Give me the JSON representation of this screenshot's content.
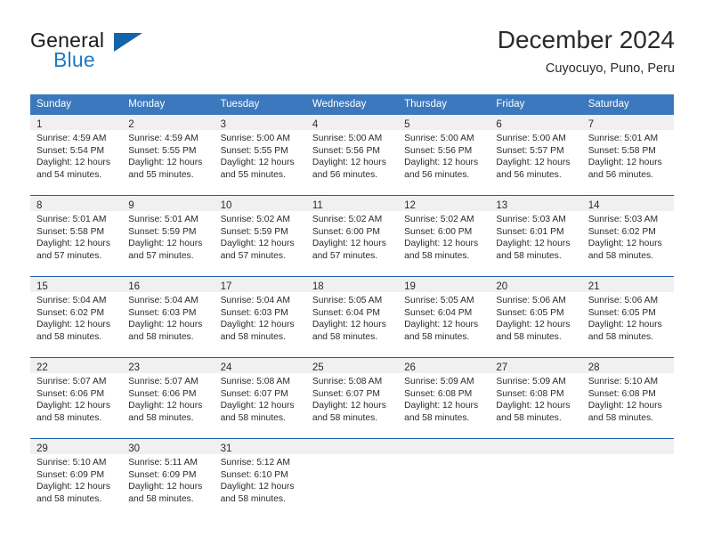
{
  "logo": {
    "word1": "General",
    "word2": "Blue",
    "triangle_color": "#1464aa",
    "blue_color": "#1e7ac4"
  },
  "header": {
    "month_title": "December 2024",
    "location": "Cuyocuyo, Puno, Peru"
  },
  "calendar": {
    "header_bg": "#3b78bd",
    "week_divider": "#1f5fa8",
    "daynum_bg": "#f0f0f0",
    "weekdays": [
      "Sunday",
      "Monday",
      "Tuesday",
      "Wednesday",
      "Thursday",
      "Friday",
      "Saturday"
    ],
    "weeks": [
      [
        {
          "day": "1",
          "sunrise": "Sunrise: 4:59 AM",
          "sunset": "Sunset: 5:54 PM",
          "daylight1": "Daylight: 12 hours",
          "daylight2": "and 54 minutes."
        },
        {
          "day": "2",
          "sunrise": "Sunrise: 4:59 AM",
          "sunset": "Sunset: 5:55 PM",
          "daylight1": "Daylight: 12 hours",
          "daylight2": "and 55 minutes."
        },
        {
          "day": "3",
          "sunrise": "Sunrise: 5:00 AM",
          "sunset": "Sunset: 5:55 PM",
          "daylight1": "Daylight: 12 hours",
          "daylight2": "and 55 minutes."
        },
        {
          "day": "4",
          "sunrise": "Sunrise: 5:00 AM",
          "sunset": "Sunset: 5:56 PM",
          "daylight1": "Daylight: 12 hours",
          "daylight2": "and 56 minutes."
        },
        {
          "day": "5",
          "sunrise": "Sunrise: 5:00 AM",
          "sunset": "Sunset: 5:56 PM",
          "daylight1": "Daylight: 12 hours",
          "daylight2": "and 56 minutes."
        },
        {
          "day": "6",
          "sunrise": "Sunrise: 5:00 AM",
          "sunset": "Sunset: 5:57 PM",
          "daylight1": "Daylight: 12 hours",
          "daylight2": "and 56 minutes."
        },
        {
          "day": "7",
          "sunrise": "Sunrise: 5:01 AM",
          "sunset": "Sunset: 5:58 PM",
          "daylight1": "Daylight: 12 hours",
          "daylight2": "and 56 minutes."
        }
      ],
      [
        {
          "day": "8",
          "sunrise": "Sunrise: 5:01 AM",
          "sunset": "Sunset: 5:58 PM",
          "daylight1": "Daylight: 12 hours",
          "daylight2": "and 57 minutes."
        },
        {
          "day": "9",
          "sunrise": "Sunrise: 5:01 AM",
          "sunset": "Sunset: 5:59 PM",
          "daylight1": "Daylight: 12 hours",
          "daylight2": "and 57 minutes."
        },
        {
          "day": "10",
          "sunrise": "Sunrise: 5:02 AM",
          "sunset": "Sunset: 5:59 PM",
          "daylight1": "Daylight: 12 hours",
          "daylight2": "and 57 minutes."
        },
        {
          "day": "11",
          "sunrise": "Sunrise: 5:02 AM",
          "sunset": "Sunset: 6:00 PM",
          "daylight1": "Daylight: 12 hours",
          "daylight2": "and 57 minutes."
        },
        {
          "day": "12",
          "sunrise": "Sunrise: 5:02 AM",
          "sunset": "Sunset: 6:00 PM",
          "daylight1": "Daylight: 12 hours",
          "daylight2": "and 58 minutes."
        },
        {
          "day": "13",
          "sunrise": "Sunrise: 5:03 AM",
          "sunset": "Sunset: 6:01 PM",
          "daylight1": "Daylight: 12 hours",
          "daylight2": "and 58 minutes."
        },
        {
          "day": "14",
          "sunrise": "Sunrise: 5:03 AM",
          "sunset": "Sunset: 6:02 PM",
          "daylight1": "Daylight: 12 hours",
          "daylight2": "and 58 minutes."
        }
      ],
      [
        {
          "day": "15",
          "sunrise": "Sunrise: 5:04 AM",
          "sunset": "Sunset: 6:02 PM",
          "daylight1": "Daylight: 12 hours",
          "daylight2": "and 58 minutes."
        },
        {
          "day": "16",
          "sunrise": "Sunrise: 5:04 AM",
          "sunset": "Sunset: 6:03 PM",
          "daylight1": "Daylight: 12 hours",
          "daylight2": "and 58 minutes."
        },
        {
          "day": "17",
          "sunrise": "Sunrise: 5:04 AM",
          "sunset": "Sunset: 6:03 PM",
          "daylight1": "Daylight: 12 hours",
          "daylight2": "and 58 minutes."
        },
        {
          "day": "18",
          "sunrise": "Sunrise: 5:05 AM",
          "sunset": "Sunset: 6:04 PM",
          "daylight1": "Daylight: 12 hours",
          "daylight2": "and 58 minutes."
        },
        {
          "day": "19",
          "sunrise": "Sunrise: 5:05 AM",
          "sunset": "Sunset: 6:04 PM",
          "daylight1": "Daylight: 12 hours",
          "daylight2": "and 58 minutes."
        },
        {
          "day": "20",
          "sunrise": "Sunrise: 5:06 AM",
          "sunset": "Sunset: 6:05 PM",
          "daylight1": "Daylight: 12 hours",
          "daylight2": "and 58 minutes."
        },
        {
          "day": "21",
          "sunrise": "Sunrise: 5:06 AM",
          "sunset": "Sunset: 6:05 PM",
          "daylight1": "Daylight: 12 hours",
          "daylight2": "and 58 minutes."
        }
      ],
      [
        {
          "day": "22",
          "sunrise": "Sunrise: 5:07 AM",
          "sunset": "Sunset: 6:06 PM",
          "daylight1": "Daylight: 12 hours",
          "daylight2": "and 58 minutes."
        },
        {
          "day": "23",
          "sunrise": "Sunrise: 5:07 AM",
          "sunset": "Sunset: 6:06 PM",
          "daylight1": "Daylight: 12 hours",
          "daylight2": "and 58 minutes."
        },
        {
          "day": "24",
          "sunrise": "Sunrise: 5:08 AM",
          "sunset": "Sunset: 6:07 PM",
          "daylight1": "Daylight: 12 hours",
          "daylight2": "and 58 minutes."
        },
        {
          "day": "25",
          "sunrise": "Sunrise: 5:08 AM",
          "sunset": "Sunset: 6:07 PM",
          "daylight1": "Daylight: 12 hours",
          "daylight2": "and 58 minutes."
        },
        {
          "day": "26",
          "sunrise": "Sunrise: 5:09 AM",
          "sunset": "Sunset: 6:08 PM",
          "daylight1": "Daylight: 12 hours",
          "daylight2": "and 58 minutes."
        },
        {
          "day": "27",
          "sunrise": "Sunrise: 5:09 AM",
          "sunset": "Sunset: 6:08 PM",
          "daylight1": "Daylight: 12 hours",
          "daylight2": "and 58 minutes."
        },
        {
          "day": "28",
          "sunrise": "Sunrise: 5:10 AM",
          "sunset": "Sunset: 6:08 PM",
          "daylight1": "Daylight: 12 hours",
          "daylight2": "and 58 minutes."
        }
      ],
      [
        {
          "day": "29",
          "sunrise": "Sunrise: 5:10 AM",
          "sunset": "Sunset: 6:09 PM",
          "daylight1": "Daylight: 12 hours",
          "daylight2": "and 58 minutes."
        },
        {
          "day": "30",
          "sunrise": "Sunrise: 5:11 AM",
          "sunset": "Sunset: 6:09 PM",
          "daylight1": "Daylight: 12 hours",
          "daylight2": "and 58 minutes."
        },
        {
          "day": "31",
          "sunrise": "Sunrise: 5:12 AM",
          "sunset": "Sunset: 6:10 PM",
          "daylight1": "Daylight: 12 hours",
          "daylight2": "and 58 minutes."
        },
        {
          "day": "",
          "sunrise": "",
          "sunset": "",
          "daylight1": "",
          "daylight2": ""
        },
        {
          "day": "",
          "sunrise": "",
          "sunset": "",
          "daylight1": "",
          "daylight2": ""
        },
        {
          "day": "",
          "sunrise": "",
          "sunset": "",
          "daylight1": "",
          "daylight2": ""
        },
        {
          "day": "",
          "sunrise": "",
          "sunset": "",
          "daylight1": "",
          "daylight2": ""
        }
      ]
    ]
  }
}
